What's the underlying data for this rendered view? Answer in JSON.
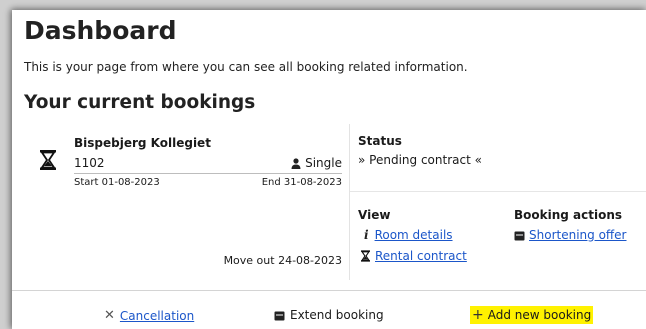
{
  "header": {
    "title": "Dashboard",
    "subtitle": "This is your page from where you can see all booking related information."
  },
  "bookings_section": {
    "title": "Your current bookings"
  },
  "booking": {
    "residence_name": "Bispebjerg Kollegiet",
    "room_number": "1102",
    "room_type": "Single",
    "start": "Start 01-08-2023",
    "end": "End 31-08-2023",
    "move_out": "Move out 24-08-2023",
    "status_label": "Status",
    "status_value": "» Pending contract «",
    "view_label": "View",
    "view_links": {
      "room_details": "Room details",
      "rental_contract": "Rental contract"
    },
    "booking_actions_label": "Booking actions",
    "booking_actions": {
      "shortening_offer": "Shortening offer"
    }
  },
  "footer_actions": {
    "cancellation": "Cancellation",
    "extend_booking": "Extend booking",
    "add_new_booking": "Add new booking"
  },
  "icons": {
    "status_icon": "hourglass-icon",
    "room_type_icon": "person-icon",
    "room_details_icon": "info-icon",
    "rental_contract_icon": "hourglass-icon",
    "shortening_offer_icon": "calendar-icon",
    "cancellation_icon": "close-icon",
    "extend_icon": "calendar-icon",
    "add_icon": "plus-icon"
  },
  "colors": {
    "link": "#1b56c9",
    "highlight": "#fff200"
  }
}
